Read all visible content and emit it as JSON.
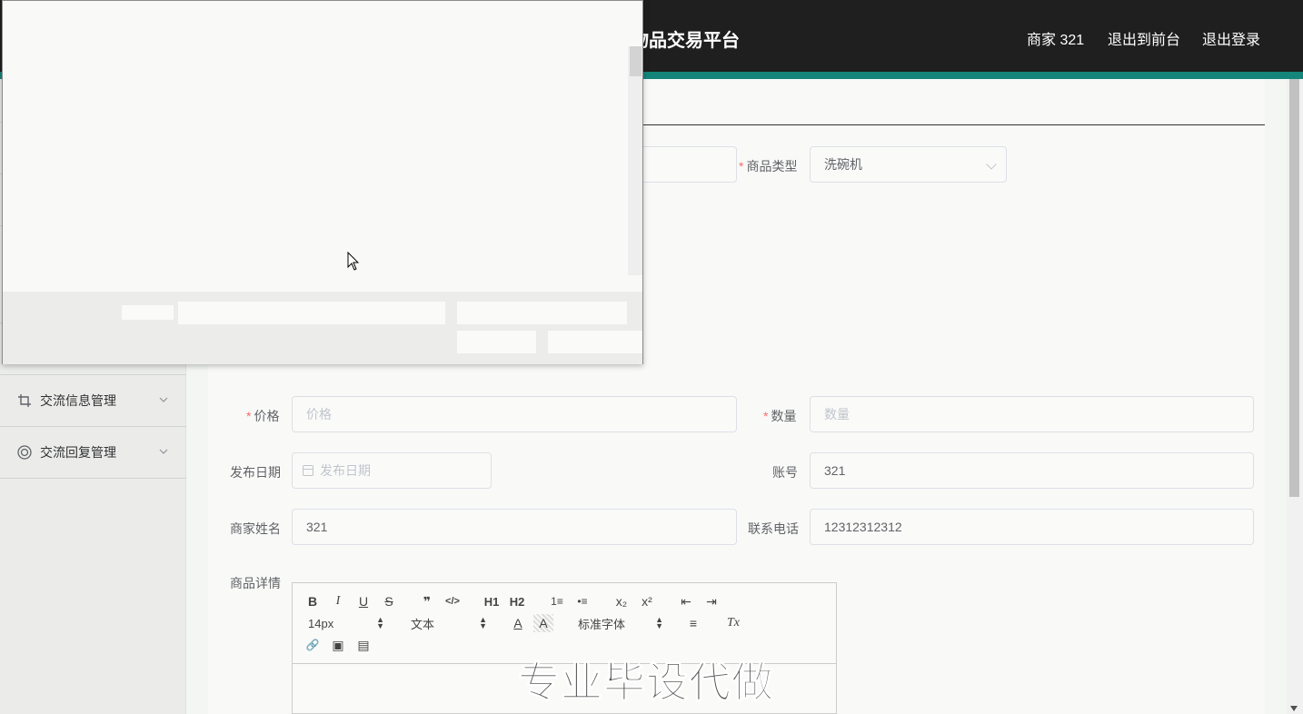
{
  "header": {
    "title": "物品交易平台",
    "nav": [
      "商家 321",
      "退出到前台",
      "退出登录"
    ]
  },
  "sidebar": {
    "items": [
      {
        "label": "交流信息管理",
        "icon": "crop-icon"
      },
      {
        "label": "交流回复管理",
        "icon": "lifebuoy-icon"
      }
    ]
  },
  "form": {
    "category_label": "商品类型",
    "category_value": "洗碗机",
    "price_label": "价格",
    "price_placeholder": "价格",
    "quantity_label": "数量",
    "quantity_placeholder": "数量",
    "date_label": "发布日期",
    "date_placeholder": "发布日期",
    "account_label": "账号",
    "account_value": "321",
    "merchant_name_label": "商家姓名",
    "merchant_name_value": "321",
    "phone_label": "联系电话",
    "phone_value": "12312312312",
    "detail_label": "商品详情"
  },
  "editor": {
    "size_value": "14px",
    "format_value": "文本",
    "font_value": "标准字体",
    "buttons": {
      "bold": "B",
      "italic": "I",
      "underline": "U",
      "strike": "S",
      "quote": "❞",
      "code": "</>",
      "h1": "H1",
      "h2": "H2",
      "ol": "1≡",
      "ul": "•≡",
      "sub": "x₂",
      "sup": "x²",
      "outdent": "⇤",
      "indent": "⇥",
      "color": "A",
      "background": "A",
      "align": "≡",
      "clean": "Tx",
      "link": "🔗",
      "image": "▣",
      "video": "▤"
    }
  },
  "watermark": "专业毕设代做",
  "colors": {
    "topbar": "#1f1f1f",
    "accent": "#14857a",
    "required": "#f56c6c"
  }
}
